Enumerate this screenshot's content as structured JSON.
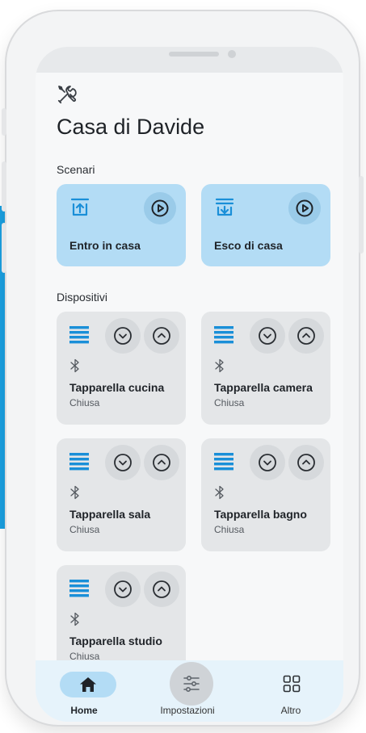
{
  "header": {
    "title": "Casa di Davide"
  },
  "sections": {
    "scenes": "Scenari",
    "devices": "Dispositivi"
  },
  "scenes": [
    {
      "label": "Entro in casa",
      "icon": "arrow-up-into-tray-icon"
    },
    {
      "label": "Esco di casa",
      "icon": "arrow-down-out-tray-icon"
    }
  ],
  "devices": [
    {
      "name": "Tapparella cucina",
      "status": "Chiusa"
    },
    {
      "name": "Tapparella camera",
      "status": "Chiusa"
    },
    {
      "name": "Tapparella sala",
      "status": "Chiusa"
    },
    {
      "name": "Tapparella bagno",
      "status": "Chiusa"
    },
    {
      "name": "Tapparella studio",
      "status": "Chiusa"
    }
  ],
  "nav": [
    {
      "label": "Home",
      "icon": "home-icon",
      "active": true
    },
    {
      "label": "Impostazioni",
      "icon": "sliders-icon",
      "active": false
    },
    {
      "label": "Altro",
      "icon": "grid-icon",
      "active": false
    }
  ],
  "colors": {
    "scene_card": "#b3dcf5",
    "device_card": "#e4e6e8",
    "accent_blue": "#1a8fd8",
    "nav_bg": "#e6f3fb"
  }
}
